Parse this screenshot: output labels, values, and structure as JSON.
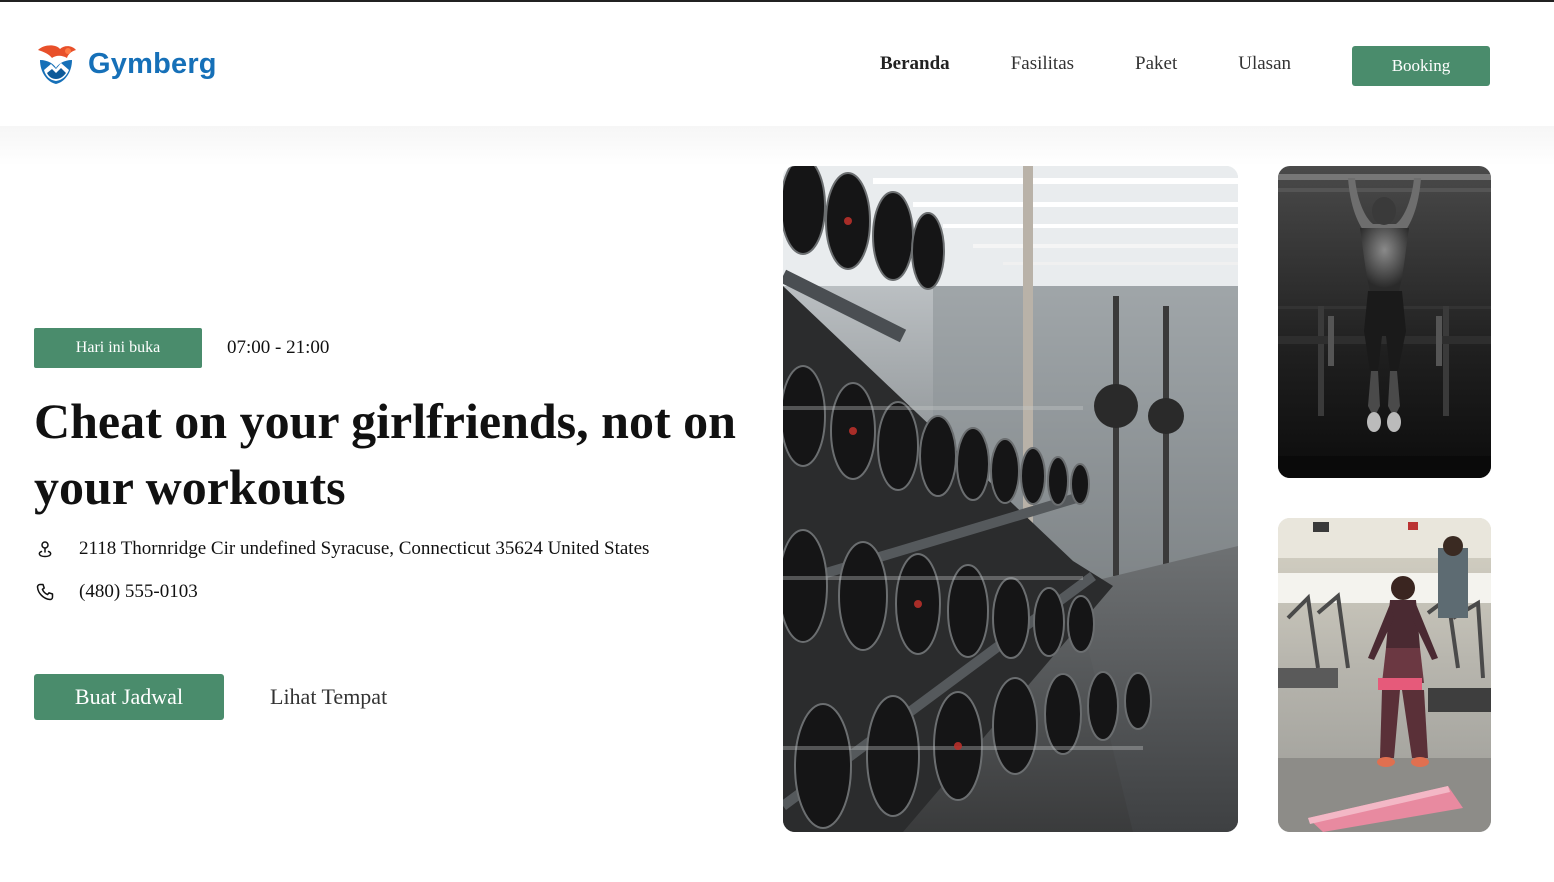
{
  "brand": {
    "name": "Gymberg"
  },
  "nav": {
    "items": [
      {
        "label": "Beranda",
        "active": true
      },
      {
        "label": "Fasilitas",
        "active": false
      },
      {
        "label": "Paket",
        "active": false
      },
      {
        "label": "Ulasan",
        "active": false
      }
    ],
    "booking_label": "Booking"
  },
  "hero": {
    "open_badge": "Hari ini buka",
    "hours": "07:00 - 21:00",
    "headline": "Cheat on your girlfriends, not on your workouts",
    "address": "2118 Thornridge Cir undefined Syracuse, Connecticut 35624 United States",
    "phone": "(480) 555-0103",
    "primary_cta": "Buat Jadwal",
    "secondary_cta": "Lihat Tempat"
  },
  "icons": {
    "logo": "gymberg-logo-icon",
    "address": "location-pin-icon",
    "phone": "phone-icon"
  },
  "images": {
    "main": "dumbbell-rack-photo",
    "top": "pull-up-athlete-photo",
    "bottom": "woman-resistance-band-photo"
  },
  "colors": {
    "accent": "#4a8c6c",
    "brand": "#1670b8",
    "logo_orange": "#e8502a"
  }
}
